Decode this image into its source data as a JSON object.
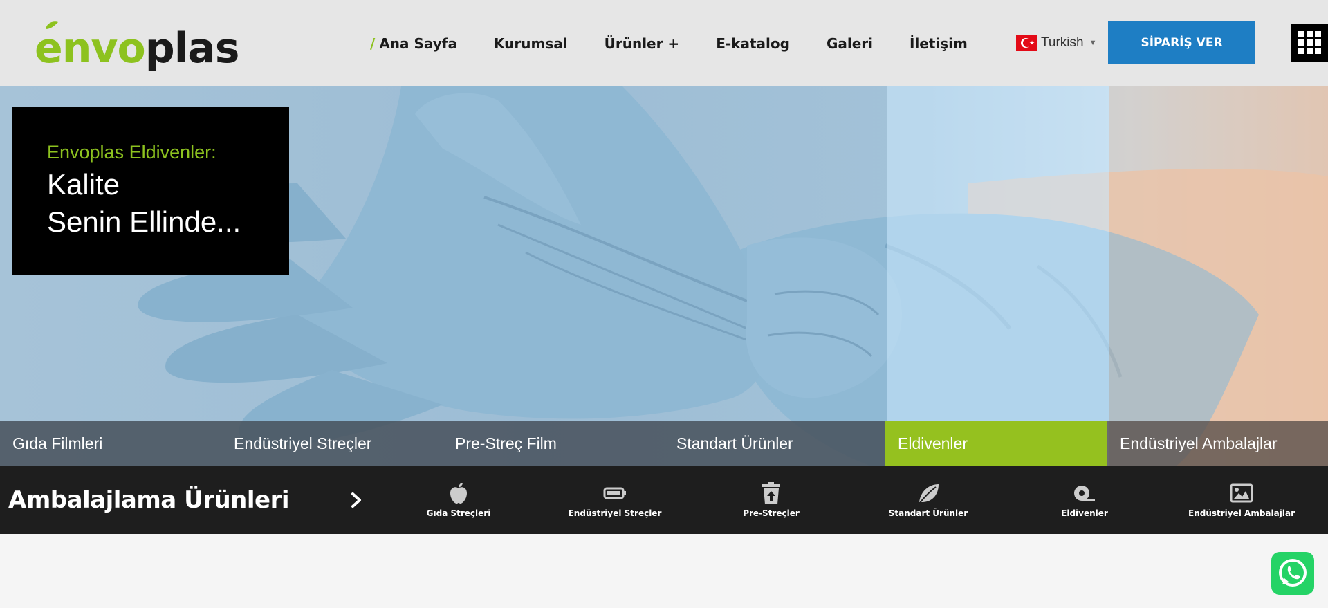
{
  "header": {
    "logo": {
      "green_part": "envo",
      "dark_part": "plas"
    },
    "nav": [
      {
        "label": "Ana Sayfa",
        "active": true
      },
      {
        "label": "Kurumsal"
      },
      {
        "label": "Ürünler +"
      },
      {
        "label": "E-katalog"
      },
      {
        "label": "Galeri"
      },
      {
        "label": "İletişim"
      }
    ],
    "nav_active_marker": "/",
    "language": {
      "label": "Turkish",
      "caret": "▼"
    },
    "order_button": "SİPARİŞ VER",
    "menu_icon": "grid-icon"
  },
  "hero": {
    "caption": {
      "subtitle": "Envoplas Eldivenler:",
      "line1": "Kalite",
      "line2": "Senin Ellinde..."
    },
    "tabs": [
      {
        "label": "Gıda Filmleri"
      },
      {
        "label": "Endüstriyel Streçler"
      },
      {
        "label": "Pre-Streç Film"
      },
      {
        "label": "Standart Ürünler"
      },
      {
        "label": "Eldivenler",
        "active": true
      },
      {
        "label": "Endüstriyel Ambalajlar"
      }
    ]
  },
  "products": {
    "title": "Ambalajlama Ürünleri",
    "items": [
      {
        "label": "Gıda Streçleri",
        "icon": "apple-icon"
      },
      {
        "label": "Endüstriyel Streçler",
        "icon": "battery-icon"
      },
      {
        "label": "Pre-Streçler",
        "icon": "trash-upload-icon"
      },
      {
        "label": "Standart Ürünler",
        "icon": "leaf-icon"
      },
      {
        "label": "Eldivenler",
        "icon": "tape-roll-icon"
      },
      {
        "label": "Endüstriyel Ambalajlar",
        "icon": "image-icon"
      }
    ]
  },
  "colors": {
    "brand_green": "#8dc21f",
    "active_tab": "#95c11f",
    "order_button": "#1e7ec4",
    "whatsapp": "#25d366"
  },
  "floating": {
    "whatsapp_icon": "whatsapp-icon"
  }
}
